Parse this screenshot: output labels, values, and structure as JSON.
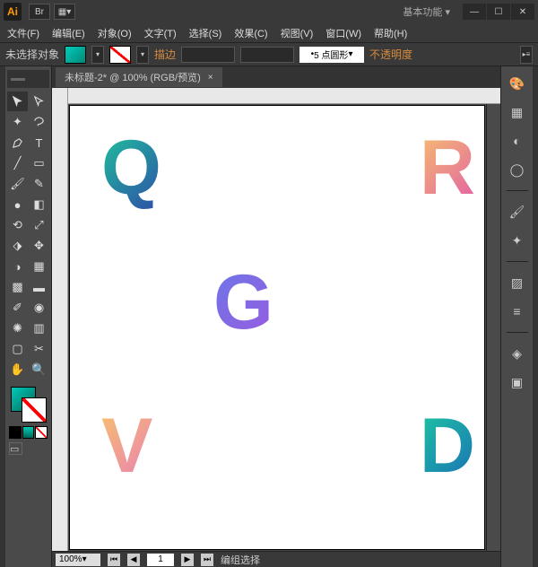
{
  "title": {
    "workspace_label": "基本功能"
  },
  "menu": {
    "file": "文件(F)",
    "edit": "编辑(E)",
    "object": "对象(O)",
    "type": "文字(T)",
    "select": "选择(S)",
    "effect": "效果(C)",
    "view": "视图(V)",
    "window": "窗口(W)",
    "help": "帮助(H)"
  },
  "ctrl": {
    "no_selection": "未选择对象",
    "stroke": "描边",
    "pt": "5 点圆形",
    "opacity": "不透明度"
  },
  "doc": {
    "tab": "未标题-2* @ 100% (RGB/预览)"
  },
  "status": {
    "zoom": "100%",
    "page": "1",
    "mode": "编组选择"
  },
  "artboard": {
    "letters": {
      "q": "Q",
      "r": "R",
      "g": "G",
      "v": "V",
      "d": "D"
    }
  }
}
